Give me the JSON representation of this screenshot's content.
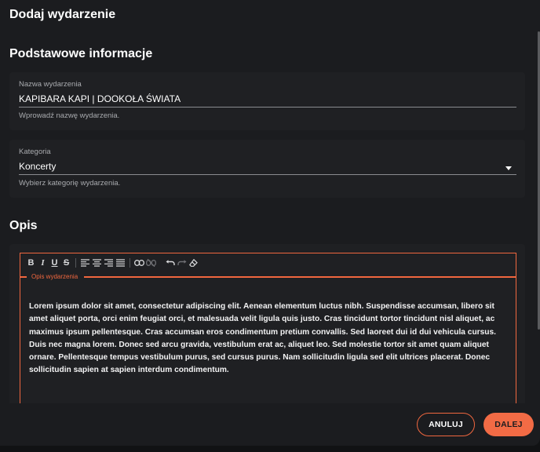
{
  "dialog": {
    "title": "Dodaj wydarzenie"
  },
  "basic": {
    "section_title": "Podstawowe informacje",
    "name": {
      "label": "Nazwa wydarzenia",
      "value": "KAPIBARA KAPI | DOOKOŁA ŚWIATA",
      "hint": "Wprowadź nazwę wydarzenia."
    },
    "category": {
      "label": "Kategoria",
      "value": "Koncerty",
      "hint": "Wybierz kategorię wydarzenia."
    }
  },
  "description": {
    "section_title": "Opis",
    "editor_label": "Opis wydarzenia",
    "toolbar": {
      "bold": "B",
      "italic": "I",
      "underline": "U",
      "strike": "S"
    },
    "text": "Lorem ipsum dolor sit amet, consectetur adipiscing elit. Aenean elementum luctus nibh. Suspendisse accumsan, libero sit amet aliquet porta, orci enim feugiat orci, et malesuada velit ligula quis justo. Cras tincidunt tortor tincidunt nisl aliquet, ac maximus ipsum pellentesque. Cras accumsan eros condimentum pretium convallis. Sed laoreet dui id dui vehicula cursus. Duis nec magna lorem. Donec sed arcu gravida, vestibulum erat ac, aliquet leo. Sed molestie tortor sit amet quam aliquet ornare. Pellentesque tempus vestibulum purus, sed cursus purus. Nam sollicitudin ligula sed elit ultrices placerat. Donec sollicitudin sapien at sapien interdum condimentum."
  },
  "footer": {
    "cancel_label": "ANULUJ",
    "next_label": "DALEJ"
  },
  "colors": {
    "accent": "#f26b45",
    "background": "#1b1c1f",
    "card": "#1f2023"
  }
}
